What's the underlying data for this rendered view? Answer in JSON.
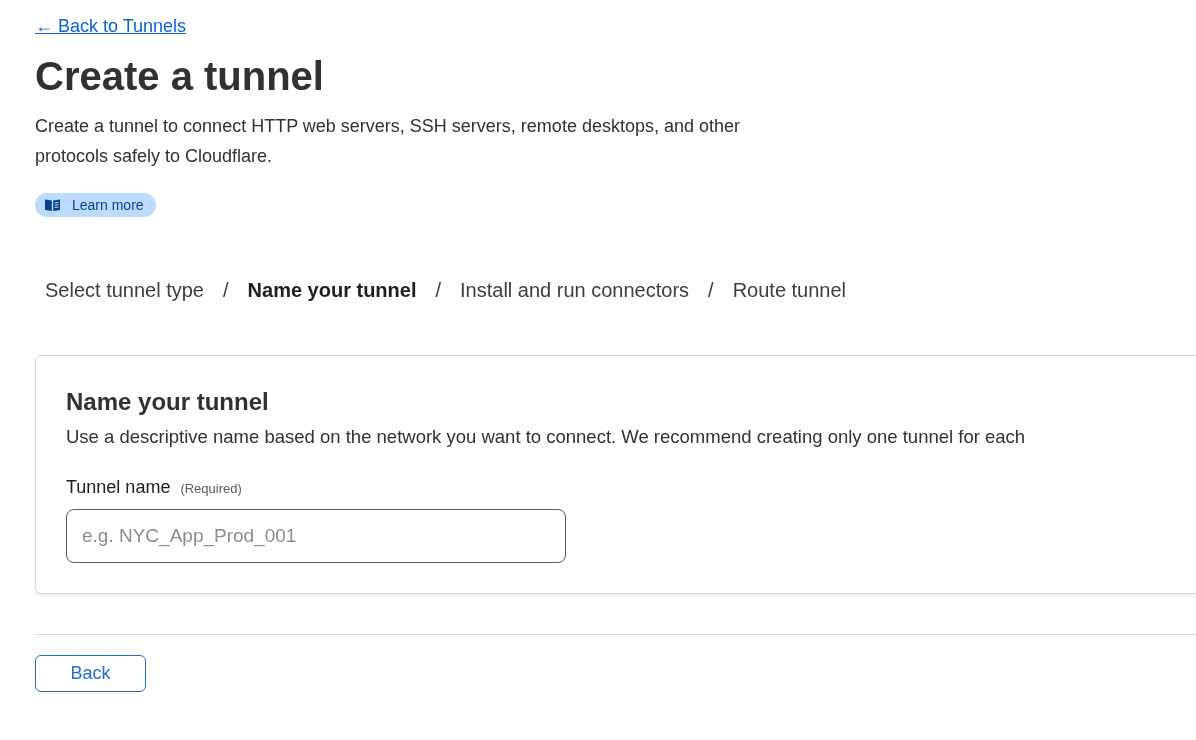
{
  "back_link": {
    "label": "← Back to Tunnels"
  },
  "header": {
    "title": "Create a tunnel",
    "description": "Create a tunnel to connect HTTP web servers, SSH servers, remote desktops, and other protocols safely to Cloudflare.",
    "learn_more": {
      "label": "Learn more"
    }
  },
  "steps": {
    "items": [
      {
        "label": "Select tunnel type",
        "selected": false
      },
      {
        "label": "Name your tunnel",
        "selected": true
      },
      {
        "label": "Install and run connectors",
        "selected": false
      },
      {
        "label": "Route tunnel",
        "selected": false
      }
    ],
    "separators": [
      "/",
      "/",
      "/"
    ]
  },
  "card": {
    "title": "Name your tunnel",
    "description": "Use a descriptive name based on the network you want to connect. We recommend creating only one tunnel for each",
    "field": {
      "label": "Tunnel name",
      "hint": "(Required)",
      "placeholder": "e.g. NYC_App_Prod_001"
    }
  },
  "footer": {
    "buttons": [
      {
        "label": "Back"
      }
    ]
  }
}
